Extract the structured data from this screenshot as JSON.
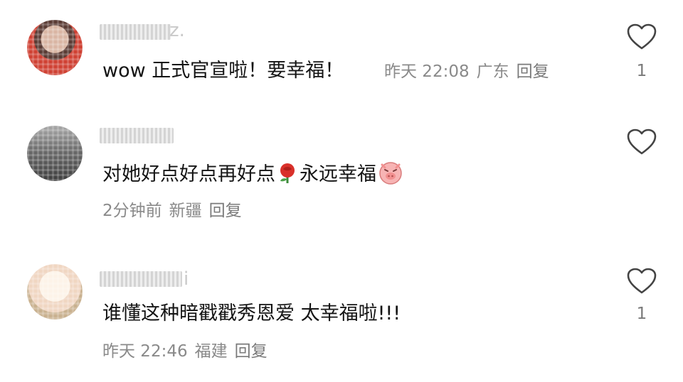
{
  "comments": [
    {
      "username_tail": "z.",
      "text_main": "wow 正式官宣啦！要幸福！",
      "time": "昨天 22:08",
      "location": "广东",
      "reply_label": "回复",
      "likes": "1"
    },
    {
      "username_tail": "",
      "text_part1": "对她好点好点再好点",
      "text_part2": "永远幸福",
      "emoji1": "rose-emoji",
      "emoji2": "piggy-emoji",
      "time": "2分钟前",
      "location": "新疆",
      "reply_label": "回复",
      "likes": ""
    },
    {
      "username_tail": "i",
      "text_main": "谁懂这种暗戳戳秀恩爱 太幸福啦!!!",
      "time": "昨天 22:46",
      "location": "福建",
      "reply_label": "回复",
      "likes": "1"
    }
  ],
  "icons": {
    "like": "heart-outline-icon",
    "avatar": "pixelated-avatar"
  },
  "colors": {
    "text": "#141414",
    "meta": "#8a8a8a",
    "icon": "#444444"
  }
}
